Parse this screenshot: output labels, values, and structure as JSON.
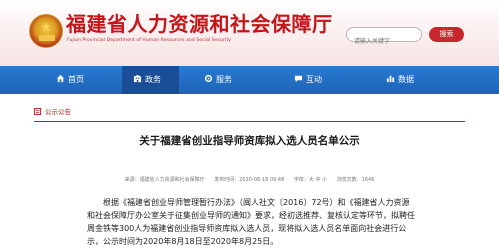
{
  "site": {
    "title": "福建省人力资源和社会保障厅",
    "subtitle": "Fujian Provincial Department of Human Resources and Social Security"
  },
  "search": {
    "placeholder": "请输入关键字",
    "button_label": "搜索"
  },
  "nav": {
    "items": [
      {
        "label": "首页",
        "icon": "home-icon"
      },
      {
        "label": "政务",
        "icon": "building-icon"
      },
      {
        "label": "服务",
        "icon": "settings-icon"
      },
      {
        "label": "互动",
        "icon": "chat-icon"
      },
      {
        "label": "数据",
        "icon": "chart-icon"
      }
    ],
    "active_index": 1
  },
  "breadcrumb": {
    "label": "公示公告"
  },
  "article": {
    "title": "关于福建省创业指导师资库拟入选人员名单公示",
    "meta": {
      "source": "来源：福建省人力资源和社会保障厅",
      "date": "发布时间：2020-08-18 09:48",
      "font_size": "字体：大  中  小",
      "views": "浏览次数：1646"
    },
    "body": "根据《福建省创业导师管理暂行办法》（闽人社文〔2016〕72号）和《福建省人力资源和社会保障厅办公室关于征集创业导师的通知》要求，经初选推荐、复核认定等环节，拟聘任周金铁等300人为福建省创业指导师资库拟入选人员，现将拟入选人员名单面向社会进行公示，公示时间为2020年8月18日至2020年8月25日。"
  },
  "colors": {
    "brand_red": "#c5141a",
    "nav_blue": "#1b63b8",
    "nav_active": "#1a4f97"
  }
}
